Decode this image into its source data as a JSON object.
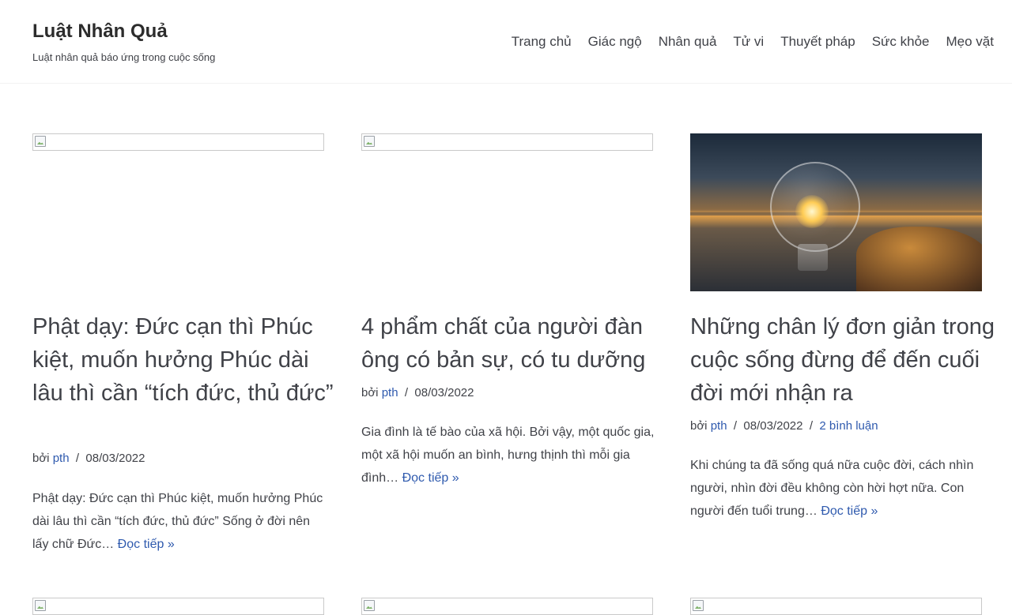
{
  "site": {
    "title": "Luật Nhân Quả",
    "tagline": "Luật nhân quả báo ứng trong cuộc sống"
  },
  "nav": [
    {
      "label": "Trang chủ"
    },
    {
      "label": "Giác ngộ"
    },
    {
      "label": "Nhân quả"
    },
    {
      "label": "Tử vi"
    },
    {
      "label": "Thuyết pháp"
    },
    {
      "label": "Sức khỏe"
    },
    {
      "label": "Mẹo vặt"
    }
  ],
  "posts": [
    {
      "title": "Phật dạy: Đức cạn thì Phúc kiệt, muốn hưởng Phúc dài lâu thì cần “tích đức, thủ đức”",
      "by": "bởi",
      "author": "pth",
      "sep": "/",
      "date": "08/03/2022",
      "excerpt": "Phật dạy: Đức cạn thì Phúc kiệt, muốn hưởng Phúc dài lâu thì cần “tích đức, thủ đức” Sống ở đời nên lấy chữ Đức…",
      "more": "Đọc tiếp »"
    },
    {
      "title": "4 phẩm chất của người đàn ông có bản sự, có tu dưỡng",
      "by": "bởi",
      "author": "pth",
      "sep": "/",
      "date": "08/03/2022",
      "excerpt": "Gia đình là tế bào của xã hội. Bởi vậy, một quốc gia, một xã hội muốn an bình, hưng thịnh thì mỗi gia đình…",
      "more": "Đọc tiếp »"
    },
    {
      "title": "Những chân lý đơn giản trong cuộc sống đừng để đến cuối đời mới nhận ra",
      "by": "bởi",
      "author": "pth",
      "sep": "/",
      "date": "08/03/2022",
      "sep2": "/",
      "comments": "2 bình luận",
      "excerpt": "Khi chúng ta đã sống quá nữa cuộc đời, cách nhìn người, nhìn đời đều không còn hời hợt nữa. Con người đến tuổi trung…",
      "more": "Đọc tiếp »"
    }
  ]
}
